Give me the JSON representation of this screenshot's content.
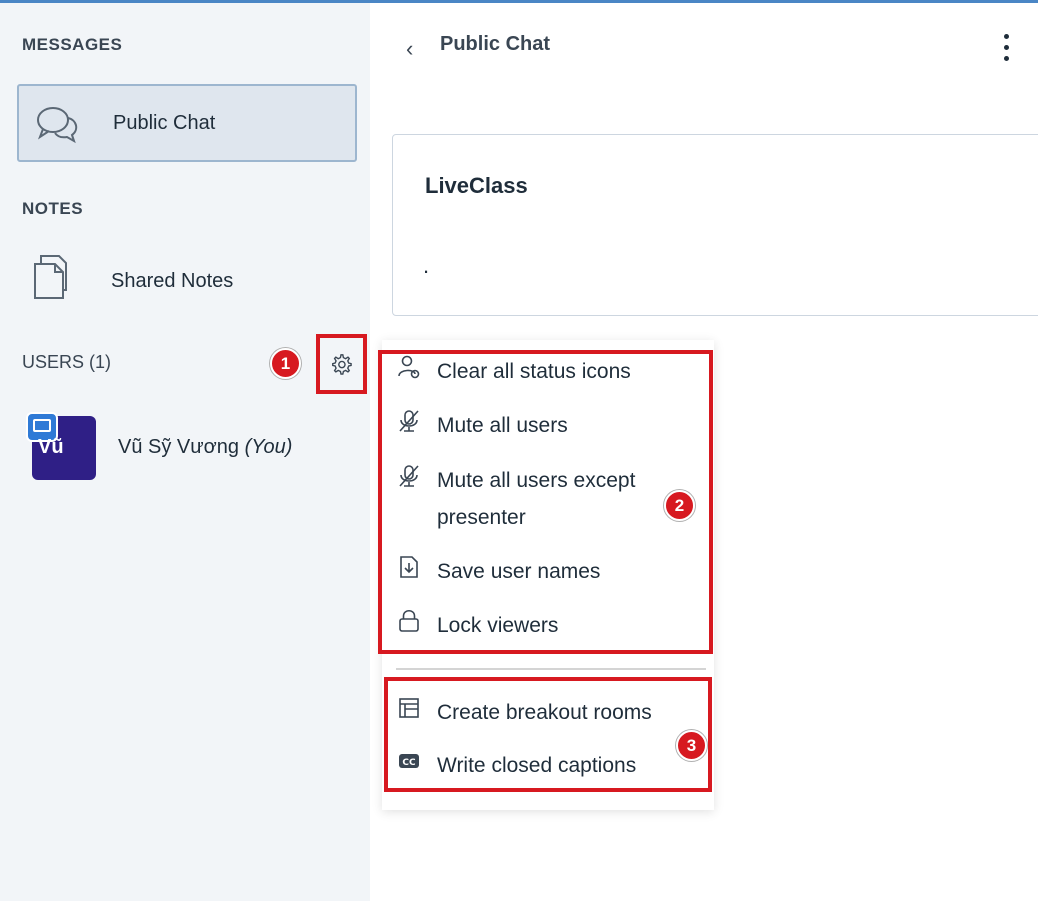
{
  "sidebar": {
    "messages_title": "MESSAGES",
    "public_chat_label": "Public Chat",
    "notes_title": "NOTES",
    "shared_notes_label": "Shared Notes",
    "users_title": "USERS (1)",
    "user": {
      "initials": "Vũ",
      "name": "Vũ Sỹ Vương",
      "you_tag": "(You)"
    }
  },
  "chat": {
    "title": "Public Chat",
    "welcome_title": "LiveClass",
    "welcome_body": "."
  },
  "menu": {
    "group1": [
      {
        "label": "Clear all status icons",
        "icon": "user-clear-icon"
      },
      {
        "label": "Mute all users",
        "icon": "mic-muted-icon"
      },
      {
        "label": "Mute all users except presenter",
        "label_line1": "Mute all users except",
        "label_line2": "presenter",
        "icon": "mic-muted-icon"
      },
      {
        "label": "Save user names",
        "icon": "download-file-icon"
      },
      {
        "label": "Lock viewers",
        "icon": "lock-icon"
      }
    ],
    "group2": [
      {
        "label": "Create breakout rooms",
        "icon": "breakout-rooms-icon"
      },
      {
        "label": "Write closed captions",
        "icon": "cc-icon"
      }
    ]
  },
  "annotations": {
    "badge1": "1",
    "badge2": "2",
    "badge3": "3"
  },
  "colors": {
    "highlight": "#d71920",
    "avatar": "#2f1f86",
    "presenter": "#2f7ad6",
    "sidebar_bg": "#f2f5f8"
  }
}
